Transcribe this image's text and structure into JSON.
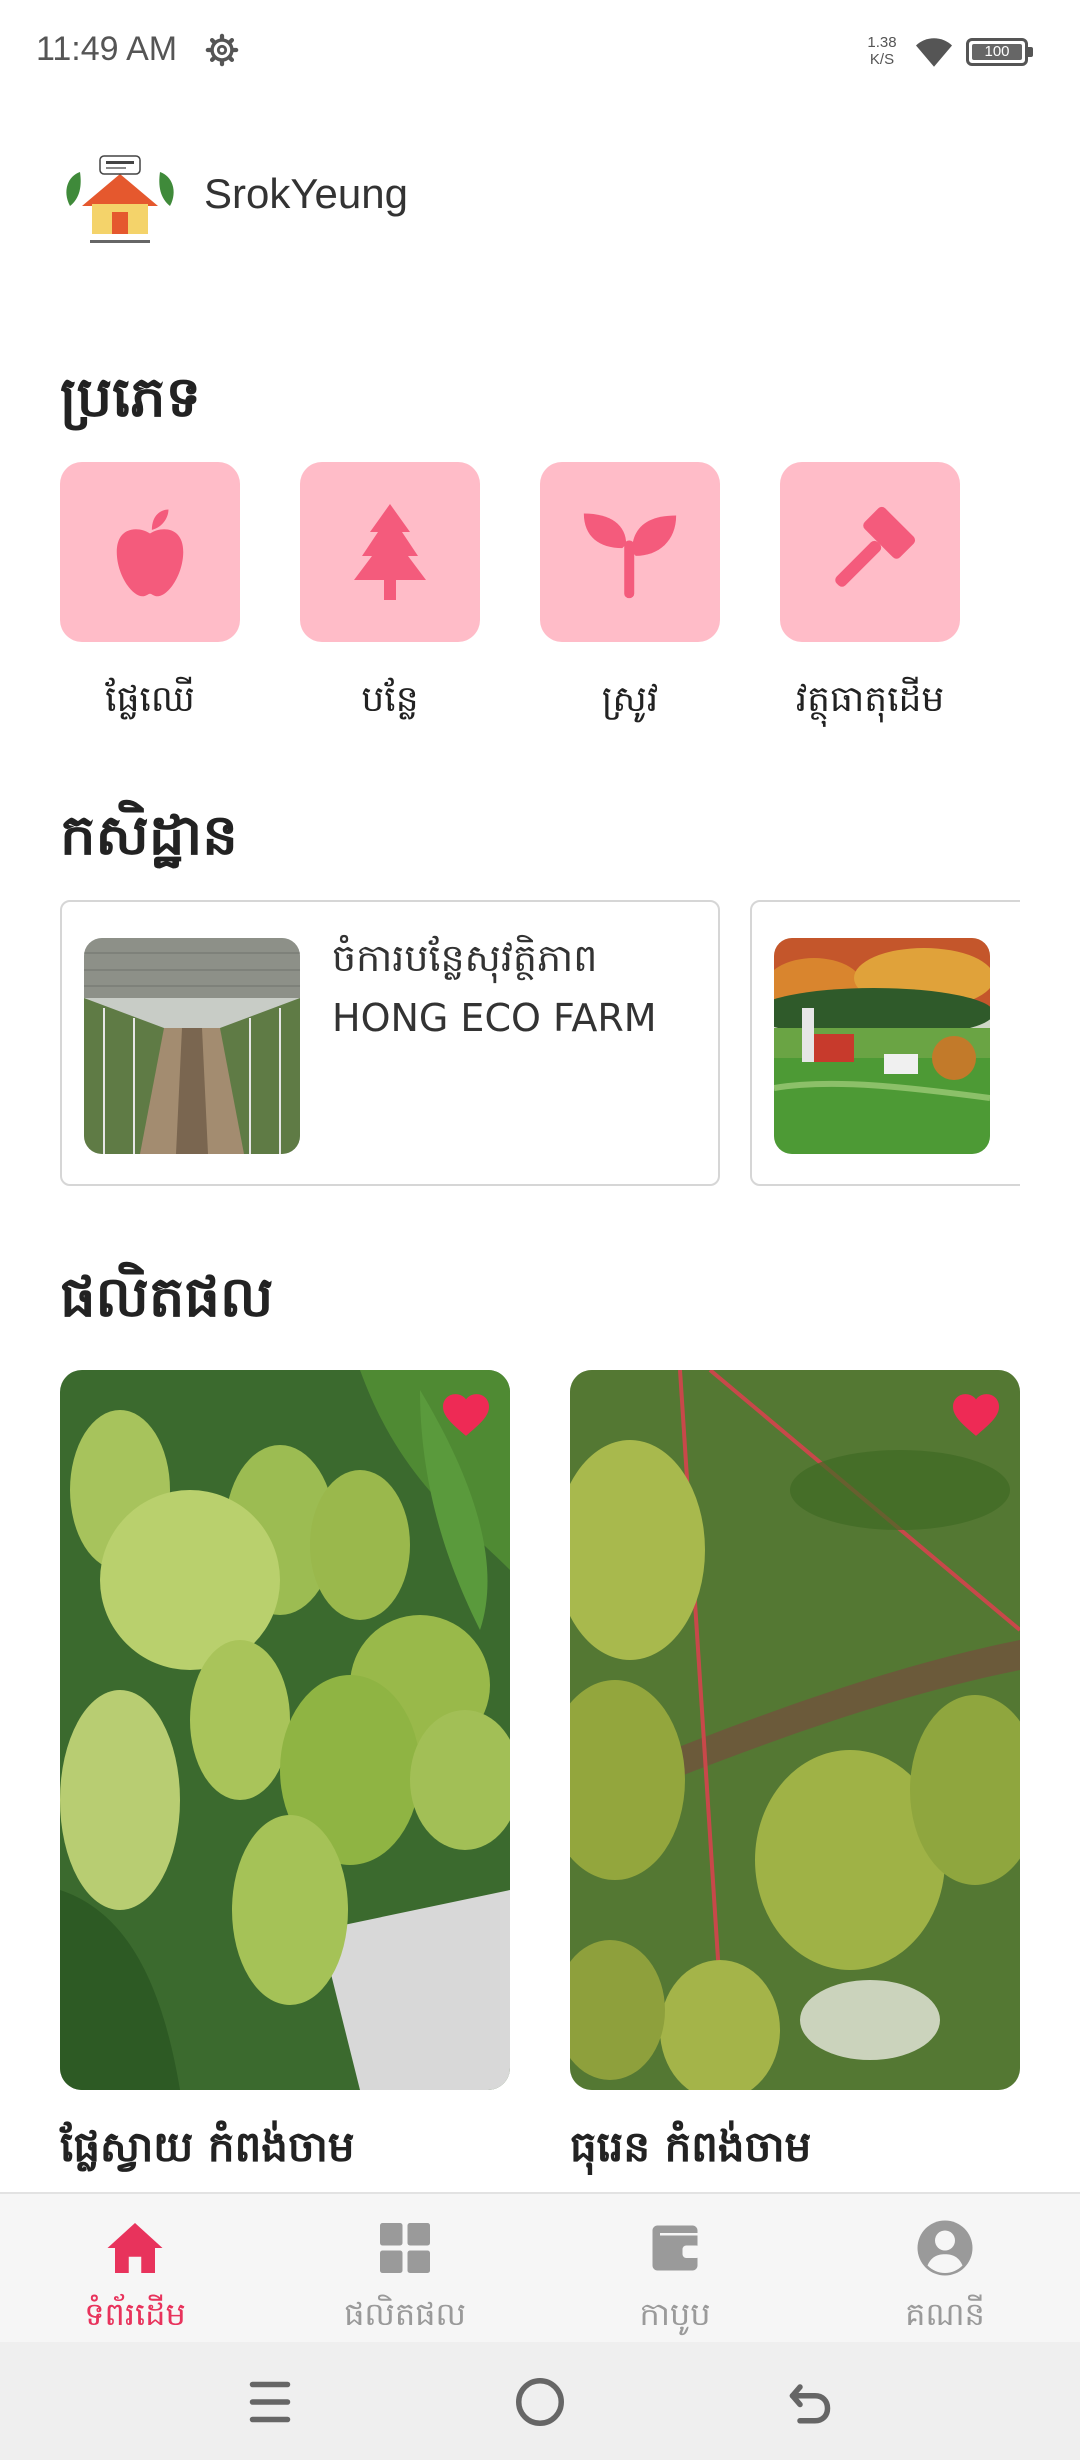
{
  "status_bar": {
    "time": "11:49 AM",
    "speed_value": "1.38",
    "speed_unit": "K/S",
    "battery": "100"
  },
  "header": {
    "app_name": "SrokYeung",
    "logo_icon": "srokyeung-logo-icon"
  },
  "categories": {
    "title": "ប្រភេទ",
    "items": [
      {
        "label": "ផ្លែឈើ",
        "icon": "apple-icon"
      },
      {
        "label": "បន្លែ",
        "icon": "tree-icon"
      },
      {
        "label": "ស្រូវ",
        "icon": "sprout-icon"
      },
      {
        "label": "វត្ថុធាតុដើម",
        "icon": "hammer-icon"
      }
    ]
  },
  "farms": {
    "title": "កសិដ្ឋាន",
    "items": [
      {
        "name": "ចំការបន្លែសុវត្ថិភាព HONG ECO FARM"
      },
      {
        "name": ""
      }
    ]
  },
  "products": {
    "title": "ផលិតផល",
    "items": [
      {
        "name": "ផ្លែស្វាយ  កំពង់ចាម"
      },
      {
        "name": "ធុរេន  កំពង់ចាម"
      }
    ]
  },
  "bottom_nav": {
    "items": [
      {
        "label": "ទំព័រដើម",
        "icon": "home-icon",
        "active": true
      },
      {
        "label": "ផលិតផល",
        "icon": "grid-icon",
        "active": false
      },
      {
        "label": "កាបូប",
        "icon": "wallet-icon",
        "active": false
      },
      {
        "label": "គណនី",
        "icon": "account-icon",
        "active": false
      }
    ]
  },
  "colors": {
    "accent": "#e8335c",
    "category_tile": "#ffbcc8",
    "category_icon": "#f45b7c"
  }
}
